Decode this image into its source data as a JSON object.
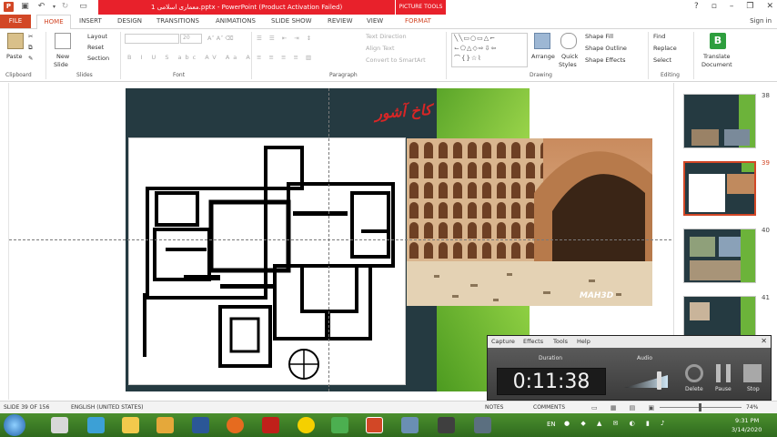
{
  "titlebar": {
    "title": "معماری اسلامی 1.pptx - PowerPoint (Product Activation Failed)",
    "context_tab": "PICTURE TOOLS",
    "sign_in": "Sign in"
  },
  "tabs": [
    "FILE",
    "HOME",
    "INSERT",
    "DESIGN",
    "TRANSITIONS",
    "ANIMATIONS",
    "SLIDE SHOW",
    "REVIEW",
    "VIEW",
    "FORMAT"
  ],
  "ribbon": {
    "clipboard": {
      "label": "Clipboard",
      "paste": "Paste"
    },
    "slides": {
      "label": "Slides",
      "new_slide_1": "New",
      "new_slide_2": "Slide",
      "layout": "Layout",
      "reset": "Reset",
      "section": "Section"
    },
    "font": {
      "label": "Font",
      "size": "20"
    },
    "paragraph": {
      "label": "Paragraph",
      "text_direction": "Text Direction",
      "align_text": "Align Text",
      "convert_smartart": "Convert to SmartArt"
    },
    "drawing": {
      "label": "Drawing",
      "arrange": "Arrange",
      "quick_styles_1": "Quick",
      "quick_styles_2": "Styles",
      "shape_fill": "Shape Fill",
      "shape_outline": "Shape Outline",
      "shape_effects": "Shape Effects"
    },
    "editing": {
      "label": "Editing",
      "find": "Find",
      "replace": "Replace",
      "select": "Select"
    },
    "translate": {
      "line1": "Translate",
      "line2": "Document"
    }
  },
  "slide": {
    "title": "کاخ آشور",
    "watermark": "MAH3D"
  },
  "thumbnails": [
    {
      "num": "38"
    },
    {
      "num": "39"
    },
    {
      "num": "40"
    },
    {
      "num": "41"
    }
  ],
  "statusbar": {
    "slide_info": "SLIDE 39 OF 156",
    "language": "ENGLISH (UNITED STATES)",
    "notes": "NOTES",
    "comments": "COMMENTS",
    "zoom": "74%"
  },
  "recorder": {
    "menu": [
      "Capture",
      "Effects",
      "Tools",
      "Help"
    ],
    "duration_label": "Duration",
    "time": "0:11:38",
    "audio_label": "Audio",
    "delete": "Delete",
    "pause": "Pause",
    "stop": "Stop"
  },
  "taskbar": {
    "lang": "EN",
    "time": "9:31 PM",
    "date": "3/14/2020"
  },
  "colors": {
    "accent": "#d24726",
    "titlebar": "#e8212b",
    "slide_bg": "#253a41",
    "slide_green": "#6cb33a"
  }
}
